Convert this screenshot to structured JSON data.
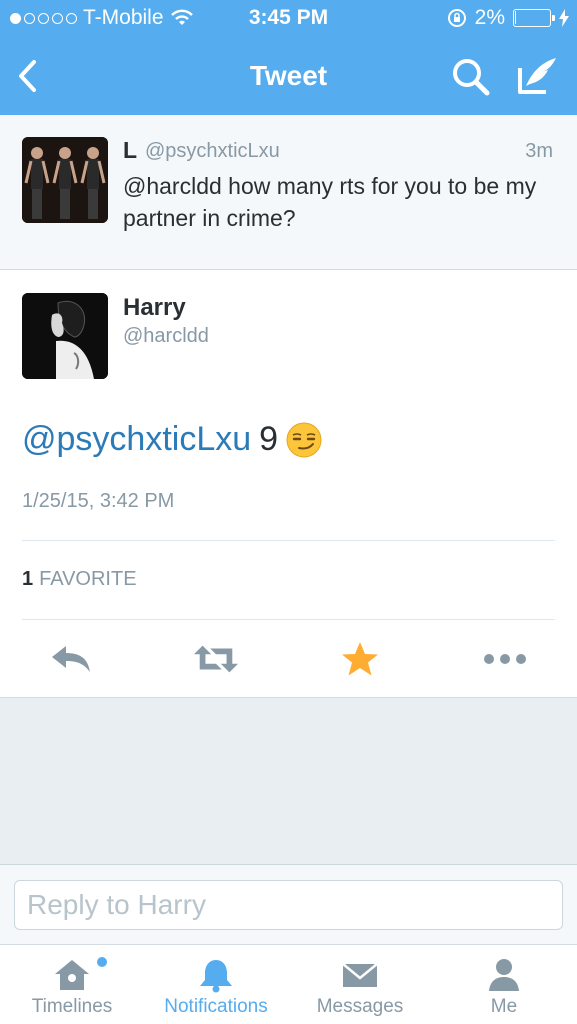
{
  "status_bar": {
    "carrier": "T-Mobile",
    "time": "3:45 PM",
    "battery": "2%",
    "battery_level": 0.02
  },
  "nav": {
    "title": "Tweet"
  },
  "parent_tweet": {
    "name": "L",
    "handle": "@psychxticLxu",
    "time": "3m",
    "text": "@harcldd how many rts for you to be my partner in crime?"
  },
  "tweet": {
    "name": "Harry",
    "handle": "@harcldd",
    "mention": "@psychxticLxu",
    "text": "9",
    "emoji": "smirking-face",
    "timestamp": "1/25/15, 3:42 PM",
    "favorites_count": "1",
    "favorites_label": "FAVORITE"
  },
  "actions": [
    {
      "name": "reply-icon"
    },
    {
      "name": "retweet-icon"
    },
    {
      "name": "favorite-star-icon",
      "color": "#ffac33"
    },
    {
      "name": "more-icon"
    }
  ],
  "reply": {
    "placeholder": "Reply to Harry"
  },
  "tabs": [
    {
      "label": "Timelines",
      "icon": "home-icon"
    },
    {
      "label": "Notifications",
      "icon": "bell-icon",
      "active": true
    },
    {
      "label": "Messages",
      "icon": "envelope-icon"
    },
    {
      "label": "Me",
      "icon": "person-icon"
    }
  ],
  "colors": {
    "accent": "#55acee",
    "link": "#2b7bb9",
    "muted": "#8899a6",
    "text": "#292f33"
  }
}
